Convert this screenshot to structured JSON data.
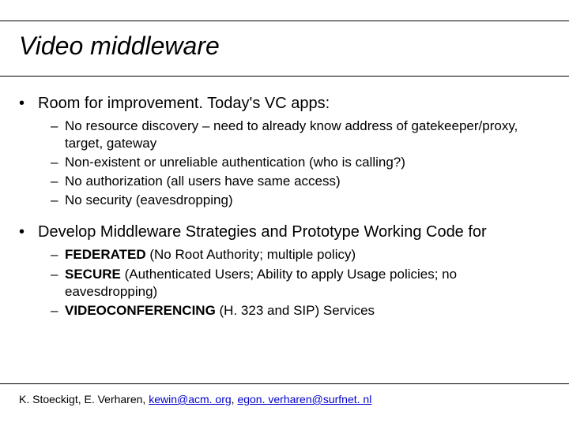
{
  "title": "Video middleware",
  "bullets": [
    {
      "text": "Room for improvement. Today's VC apps:",
      "sub": [
        "No resource discovery – need to already know address of gatekeeper/proxy, target, gateway",
        "Non-existent or unreliable authentication (who is calling?)",
        "No authorization (all users have same access)",
        "No security (eavesdropping)"
      ]
    },
    {
      "text": "Develop Middleware Strategies and Prototype Working Code for",
      "sub_bold": [
        {
          "bold": "FEDERATED",
          "rest": " (No Root Authority; multiple policy)"
        },
        {
          "bold": "SECURE",
          "rest": " (Authenticated Users; Ability to apply Usage policies; no eavesdropping)"
        },
        {
          "bold": "VIDEOCONFERENCING",
          "rest": " (H. 323 and SIP) Services"
        }
      ]
    }
  ],
  "footer": {
    "names": "K. Stoeckigt, E. Verharen, ",
    "email1": "kewin@acm. org",
    "sep": ", ",
    "email2": "egon. verharen@surfnet. nl"
  }
}
